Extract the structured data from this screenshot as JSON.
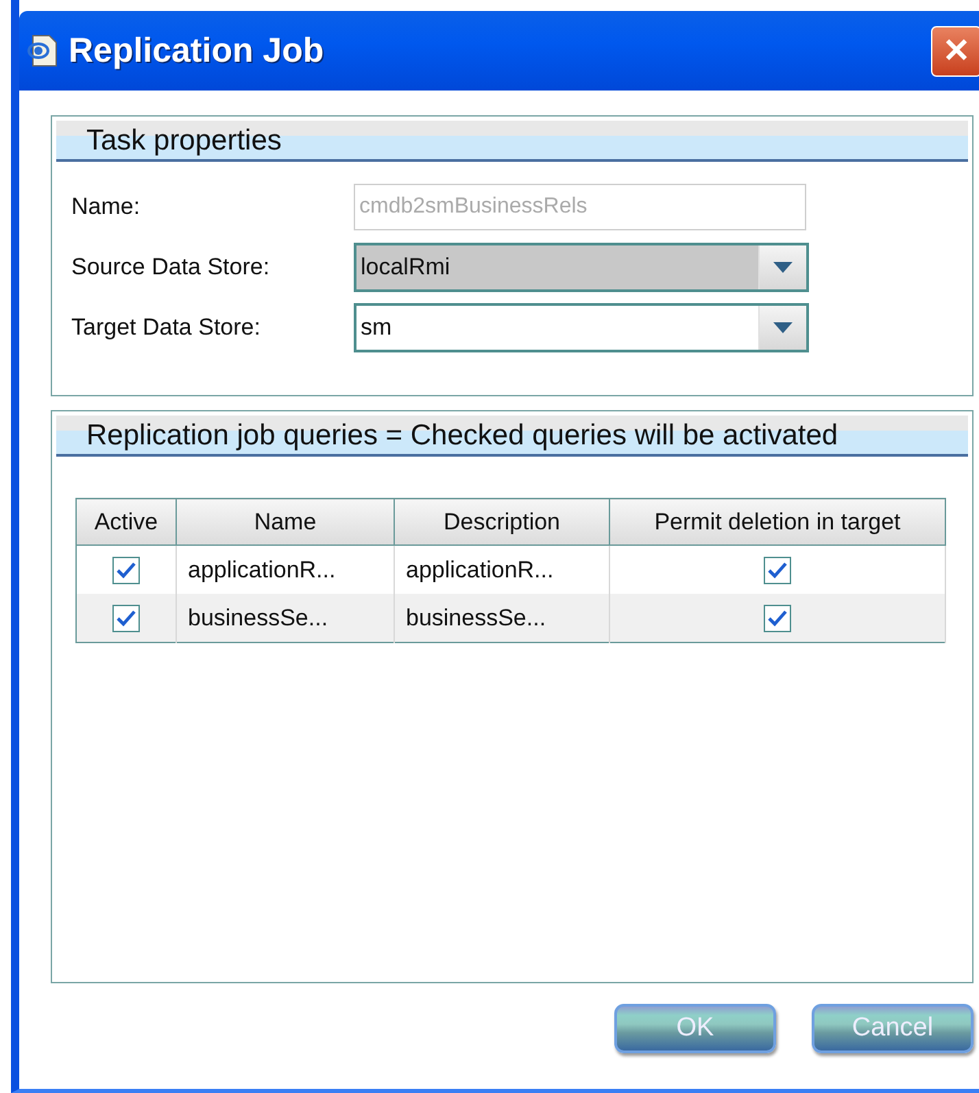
{
  "window": {
    "title": "Replication Job",
    "close": "✕"
  },
  "task_properties": {
    "title": "Task properties",
    "fields": [
      {
        "kind": "text",
        "label": "Name:",
        "value": "cmdb2smBusinessRels",
        "disabled": true,
        "highlighted": false
      },
      {
        "kind": "dropdown",
        "label": "Source Data Store:",
        "value": "localRmi",
        "disabled": false,
        "highlighted": true
      },
      {
        "kind": "dropdown",
        "label": "Target Data Store:",
        "value": "sm",
        "disabled": false,
        "highlighted": false
      }
    ]
  },
  "queries": {
    "title": "Replication job queries = Checked queries will be activated",
    "table": {
      "columns": [
        "Active",
        "Name",
        "Description",
        "Permit deletion in target"
      ],
      "rows": [
        {
          "active": true,
          "name": "applicationR...",
          "description": "applicationR...",
          "permit_deletion": true
        },
        {
          "active": true,
          "name": "businessSe...",
          "description": "businessSe...",
          "permit_deletion": true
        }
      ]
    }
  },
  "buttons": [
    "OK",
    "Cancel"
  ]
}
